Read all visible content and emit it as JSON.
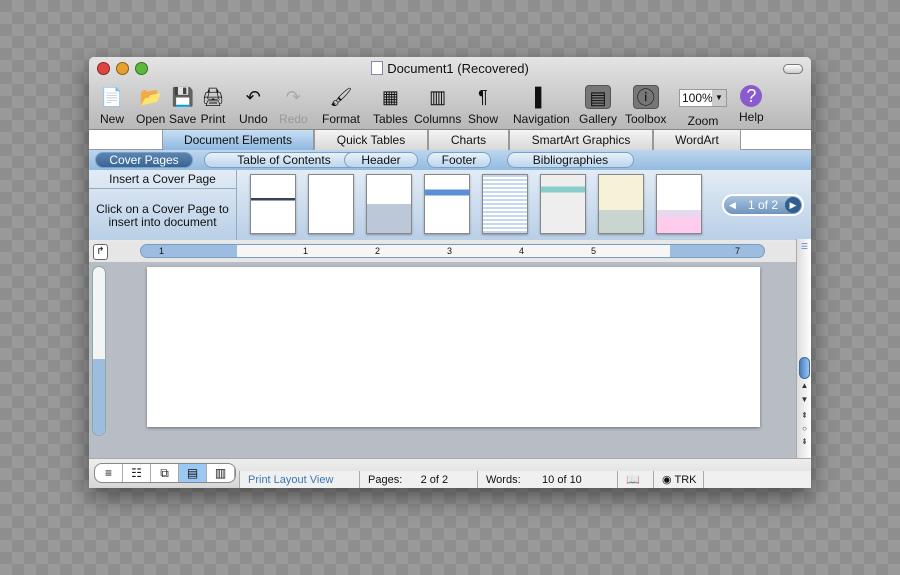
{
  "window": {
    "title": "Document1 (Recovered)"
  },
  "toolbar": [
    {
      "label": "New",
      "icon": "new-document-icon"
    },
    {
      "label": "Open",
      "icon": "open-icon"
    },
    {
      "label": "Save",
      "icon": "save-icon"
    },
    {
      "label": "Print",
      "icon": "print-icon"
    },
    {
      "label": "Undo",
      "icon": "undo-icon"
    },
    {
      "label": "Redo",
      "icon": "redo-icon"
    },
    {
      "label": "Format",
      "icon": "brush-icon"
    },
    {
      "label": "Tables",
      "icon": "table-icon"
    },
    {
      "label": "Columns",
      "icon": "columns-icon"
    },
    {
      "label": "Show",
      "icon": "pilcrow-icon"
    },
    {
      "label": "Navigation",
      "icon": "navigation-icon"
    },
    {
      "label": "Gallery",
      "icon": "gallery-icon"
    },
    {
      "label": "Toolbox",
      "icon": "toolbox-icon"
    },
    {
      "label": "Zoom",
      "value": "100%"
    },
    {
      "label": "Help",
      "icon": "help-icon"
    }
  ],
  "ribbon_tabs": [
    "Document Elements",
    "Quick Tables",
    "Charts",
    "SmartArt Graphics",
    "WordArt"
  ],
  "sub_tabs": [
    "Cover Pages",
    "Table of Contents",
    "Header",
    "Footer",
    "Bibliographies"
  ],
  "gallery": {
    "heading": "Insert a Cover Page",
    "hint": "Click on a Cover Page to insert into document",
    "pager": "1 of 2"
  },
  "ruler": {
    "labels": [
      "1",
      "1",
      "2",
      "3",
      "4",
      "5",
      "7"
    ]
  },
  "status": {
    "view": "Print Layout View",
    "pages_label": "Pages:",
    "pages": "2 of 2",
    "words_label": "Words:",
    "words": "10 of 10",
    "trk": "TRK"
  },
  "colors": {
    "accent": "#9dbde0",
    "active_subtab": "#3a6494"
  }
}
